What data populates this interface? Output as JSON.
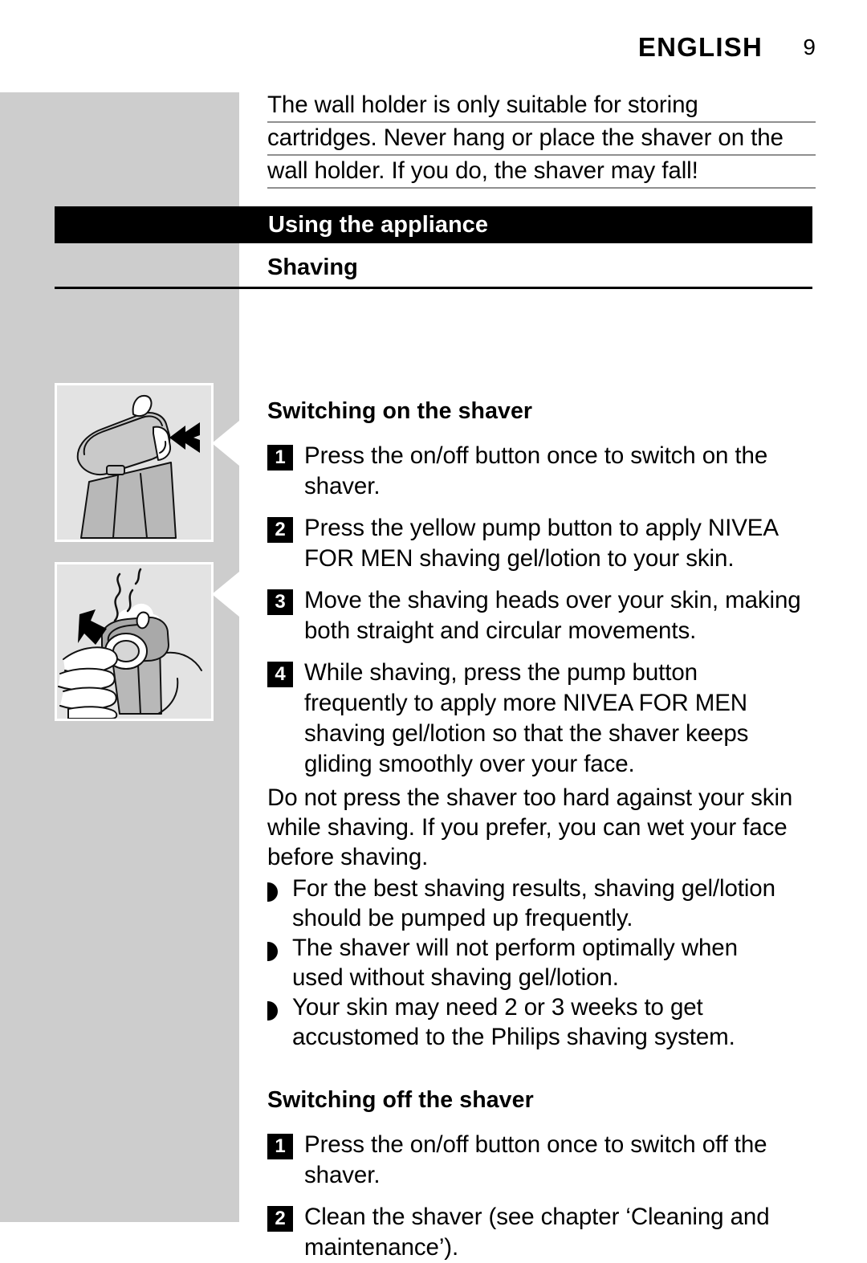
{
  "header": {
    "language": "ENGLISH",
    "page_number": "9"
  },
  "warning": {
    "lines": [
      "The wall holder is only suitable for storing",
      "cartridges. Never hang or place the shaver on the",
      "wall holder. If you do, the shaver may fall!"
    ]
  },
  "section": {
    "bar_title": "Using the appliance",
    "chapter_title": "Shaving"
  },
  "switching_on": {
    "heading": "Switching on the shaver",
    "steps": [
      {
        "number": "1",
        "lines": [
          "Press the on/off button once to switch on the",
          "shaver."
        ]
      },
      {
        "number": "2",
        "lines": [
          "Press the yellow pump button to apply NIVEA",
          "FOR MEN shaving gel/lotion to your skin."
        ]
      },
      {
        "number": "3",
        "lines": [
          "Move the shaving heads over your skin, making",
          "both straight and circular movements."
        ]
      },
      {
        "number": "4",
        "lines": [
          "While shaving, press the pump button",
          "frequently to apply more NIVEA FOR MEN",
          "shaving gel/lotion so that the shaver keeps",
          "gliding smoothly over your face."
        ]
      }
    ]
  },
  "note": {
    "lines": [
      "Do not press the shaver too hard against your skin",
      "while shaving. If you prefer, you can wet your face",
      "before shaving."
    ]
  },
  "tips": [
    {
      "lines": [
        "For the best shaving results, shaving gel/lotion",
        "should be pumped up frequently."
      ]
    },
    {
      "lines": [
        "The shaver will not perform optimally when",
        "used without shaving gel/lotion."
      ]
    },
    {
      "lines": [
        "Your skin may need 2 or 3 weeks to get",
        "accustomed to the Philips shaving system."
      ]
    }
  ],
  "switching_off": {
    "heading": "Switching off the shaver",
    "steps": [
      {
        "number": "1",
        "lines": [
          "Press the on/off button once to switch off the",
          "shaver."
        ]
      },
      {
        "number": "2",
        "lines": [
          "Clean the shaver (see chapter ‘Cleaning and",
          "maintenance’)."
        ]
      }
    ]
  },
  "figures": [
    {
      "name": "shaver-on-off-button-illustration"
    },
    {
      "name": "hand-pressing-pump-button-illustration"
    }
  ],
  "colors": {
    "margin_gray": "#cdcdcd",
    "figure_gray": "#e3e3e3",
    "rule_gray": "#8f8f8f",
    "ink": "#000000",
    "paper": "#ffffff"
  }
}
